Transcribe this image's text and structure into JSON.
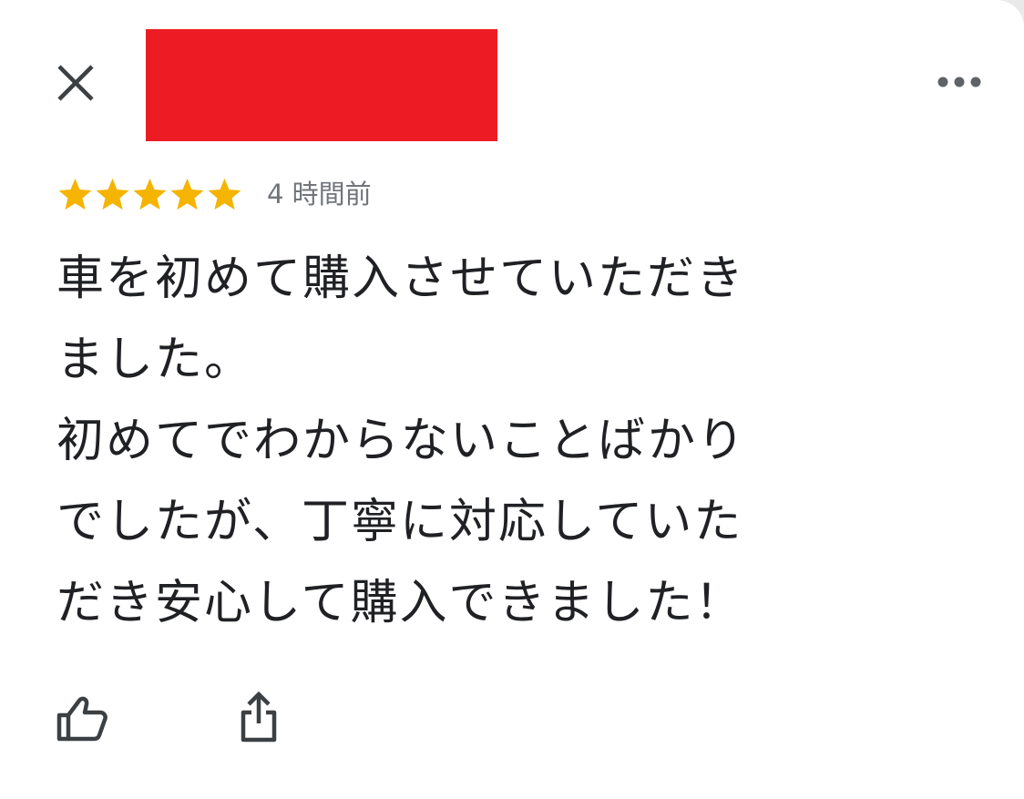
{
  "review": {
    "rating": 5,
    "rating_max": 5,
    "time_ago": "4 時間前",
    "text": "車を初めて購入させていただき\nました。\n初めてでわからないことばかり\nでしたが、丁寧に対応していた\nだき安心して購入できました！"
  },
  "icons": {
    "close": "close-icon",
    "more": "more-horizontal-icon",
    "star": "star-icon",
    "like": "thumbs-up-icon",
    "share": "share-icon"
  },
  "colors": {
    "star": "#f4b400",
    "redaction": "#ed1c24",
    "text": "#202124",
    "secondary_text": "#70757a",
    "icon": "#3c4043"
  }
}
